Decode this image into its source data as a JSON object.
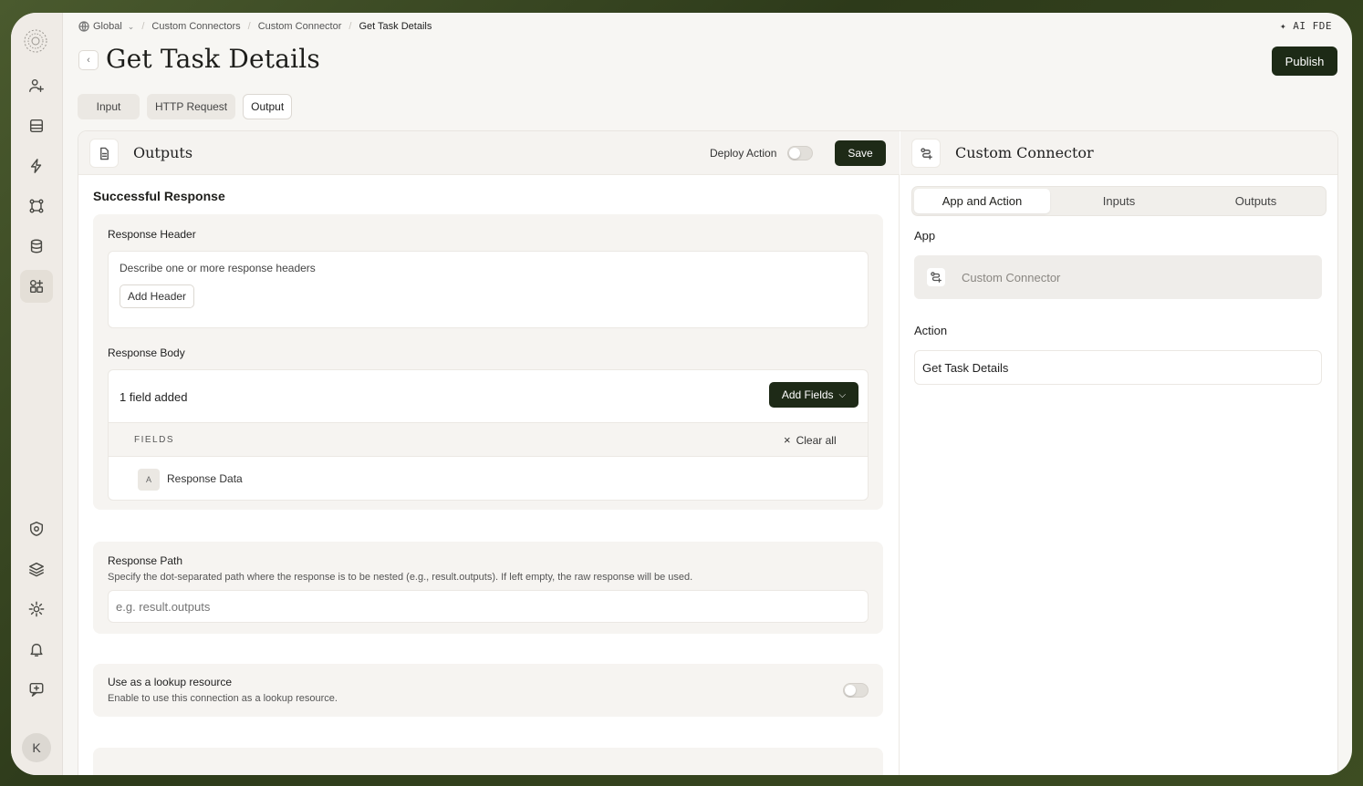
{
  "breadcrumb": {
    "scope": "Global",
    "items": [
      "Custom Connectors",
      "Custom Connector",
      "Get Task Details"
    ]
  },
  "ai_fde_label": "✦ AI FDE",
  "page": {
    "title": "Get Task Details",
    "publish_label": "Publish"
  },
  "top_tabs": [
    {
      "label": "Input",
      "active": false
    },
    {
      "label": "HTTP Request",
      "active": false
    },
    {
      "label": "Output",
      "active": true
    }
  ],
  "outputs_panel": {
    "title": "Outputs",
    "deploy_action_label": "Deploy Action",
    "deploy_action_on": false,
    "save_label": "Save",
    "section_title": "Successful Response",
    "response_header": {
      "label": "Response Header",
      "description": "Describe one or more response headers",
      "add_button": "Add Header"
    },
    "response_body": {
      "label": "Response Body",
      "count_text": "1 field added",
      "add_fields_button": "Add Fields",
      "fields_header": "FIELDS",
      "clear_all": "Clear all",
      "fields": [
        {
          "name": "Response Data",
          "type_glyph": "A"
        }
      ]
    },
    "response_path": {
      "label": "Response Path",
      "help": "Specify the dot-separated path where the response is to be nested (e.g., result.outputs). If left empty, the raw response will be used.",
      "placeholder": "e.g. result.outputs",
      "value": ""
    },
    "lookup": {
      "label": "Use as a lookup resource",
      "help": "Enable to use this connection as a lookup resource.",
      "on": false
    }
  },
  "connector_panel": {
    "title": "Custom Connector",
    "tabs": [
      {
        "label": "App and Action",
        "active": true
      },
      {
        "label": "Inputs",
        "active": false
      },
      {
        "label": "Outputs",
        "active": false
      }
    ],
    "app_label": "App",
    "app_name": "Custom Connector",
    "action_label": "Action",
    "action_value": "Get Task Details"
  },
  "sidebar": {
    "avatar_initial": "K",
    "icons": [
      "user-plus-icon",
      "inbox-icon",
      "bolt-icon",
      "workflow-icon",
      "database-icon",
      "apps-icon",
      "shield-icon",
      "layers-icon",
      "gear-icon",
      "bell-icon",
      "chat-icon"
    ]
  },
  "colors": {
    "accent_dark": "#1d2a16",
    "frame_bg": "#f7f6f3",
    "sidebar_bg": "#efebe6"
  }
}
